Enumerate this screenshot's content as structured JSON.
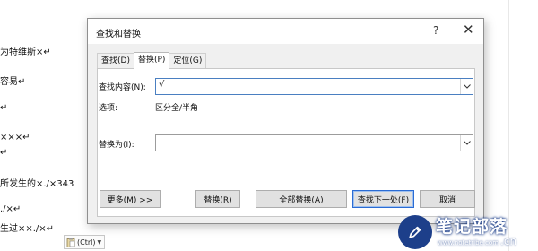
{
  "document": {
    "lines": [
      "为特维斯×↵",
      "容易↵",
      "↵",
      "×××↵",
      "↵",
      "所发生的×./×343",
      "./×↵",
      "生过××./×↵"
    ],
    "paste_options": "(Ctrl)"
  },
  "dialog": {
    "title": "查找和替换",
    "help_glyph": "?",
    "close_glyph": "✕",
    "tabs": [
      {
        "label": "查找(D)",
        "active": false
      },
      {
        "label": "替换(P)",
        "active": true
      },
      {
        "label": "定位(G)",
        "active": false
      }
    ],
    "find_label": "查找内容(N):",
    "find_value": "√",
    "options_label": "选项:",
    "options_value": "区分全/半角",
    "replace_label": "替换为(I):",
    "replace_value": "",
    "buttons": {
      "more": "更多(M) >>",
      "replace": "替换(R)",
      "replace_all": "全部替换(A)",
      "find_next": "查找下一处(F)",
      "cancel": "取消"
    }
  },
  "watermark": {
    "title": "笔记部落",
    "url": "www.notetribe.com",
    "suffix": ".cn"
  }
}
